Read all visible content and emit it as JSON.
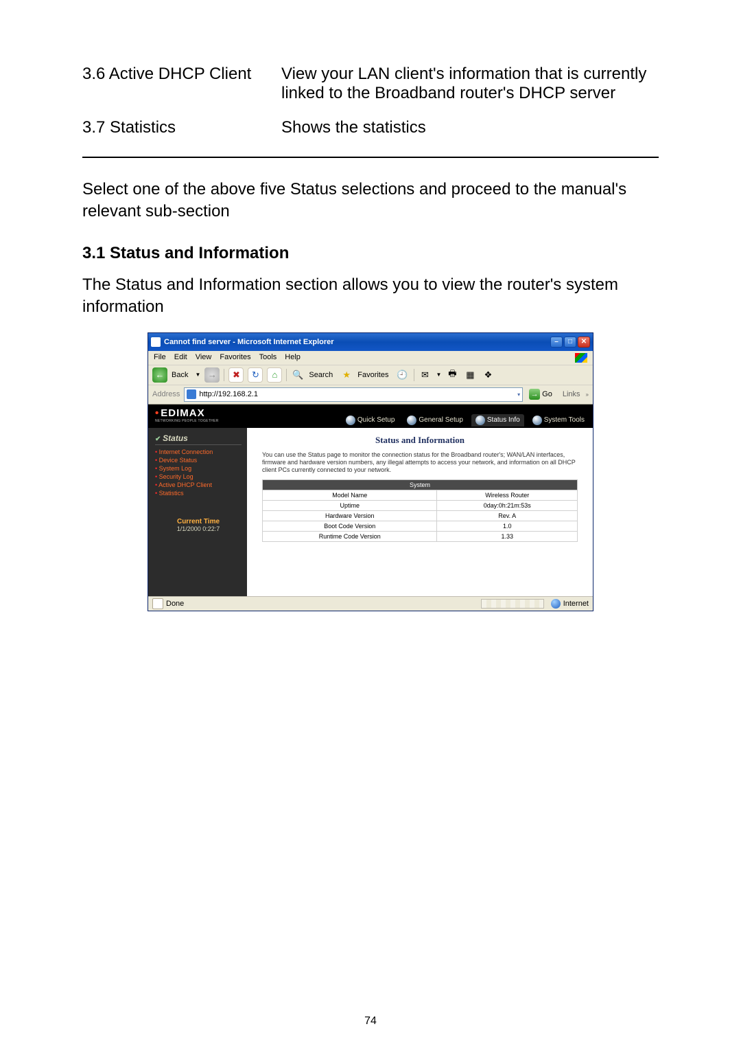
{
  "table_rows": [
    {
      "left": "3.6 Active DHCP Client",
      "right": "View your LAN client's information that is currently linked to the Broadband router's DHCP server"
    },
    {
      "left": "3.7 Statistics",
      "right": "Shows the statistics"
    }
  ],
  "instruction": "Select one of the above five Status selections and proceed to the manual's relevant sub-section",
  "section_heading": "3.1 Status and Information",
  "section_body": "The Status and Information section allows you to view the router's system information",
  "ie": {
    "title": "Cannot find server - Microsoft Internet Explorer",
    "menus": [
      "File",
      "Edit",
      "View",
      "Favorites",
      "Tools",
      "Help"
    ],
    "back_label": "Back",
    "search_label": "Search",
    "favorites_label": "Favorites",
    "address_label": "Address",
    "url": "http://192.168.2.1",
    "go_label": "Go",
    "links_label": "Links",
    "status_done": "Done",
    "status_zone": "Internet"
  },
  "router": {
    "brand": "EDIMAX",
    "brand_tag": "NETWORKING PEOPLE TOGETHER",
    "tabs": [
      "Quick Setup",
      "General Setup",
      "Status Info",
      "System Tools"
    ],
    "sidebar_header": "Status",
    "nav": [
      "Internet Connection",
      "Device Status",
      "System Log",
      "Security Log",
      "Active DHCP Client",
      "Statistics"
    ],
    "current_time_label": "Current Time",
    "current_time_value": "1/1/2000 0:22:7",
    "panel_title": "Status and Information",
    "panel_desc": "You can use the Status page to monitor the connection status for the Broadband router's; WAN/LAN interfaces, firmware and hardware version numbers, any illegal attempts to access your network, and information on all DHCP client PCs currently connected to your network.",
    "sys_header": "System",
    "sys_rows": [
      {
        "k": "Model Name",
        "v": "Wireless Router"
      },
      {
        "k": "Uptime",
        "v": "0day:0h:21m:53s"
      },
      {
        "k": "Hardware Version",
        "v": "Rev. A"
      },
      {
        "k": "Boot Code Version",
        "v": "1.0"
      },
      {
        "k": "Runtime Code Version",
        "v": "1.33"
      }
    ]
  },
  "page_number": "74"
}
